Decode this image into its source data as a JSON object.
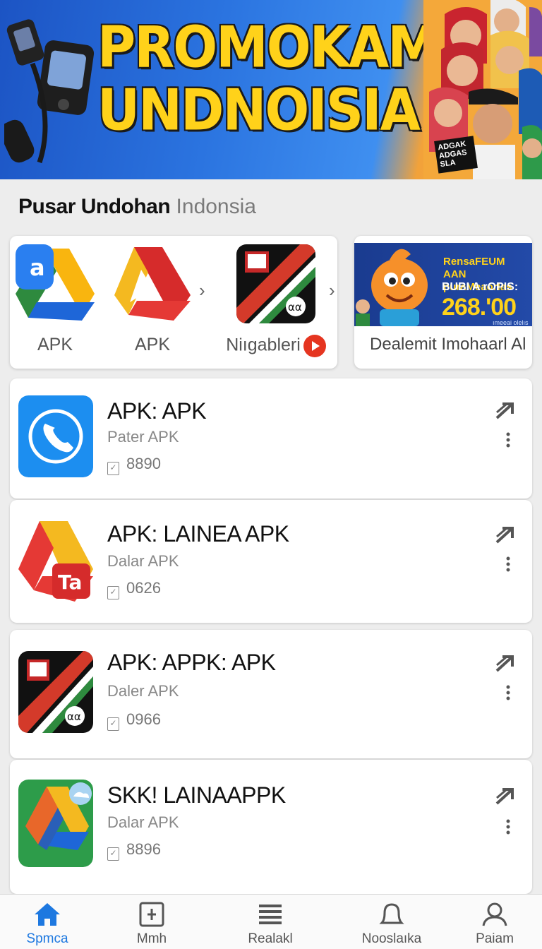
{
  "banner": {
    "title_line1": "PROMOKAM",
    "title_line2": "UNDNOISIA!",
    "sign_text": "ADGAK ADGAS SLA"
  },
  "section": {
    "title_bold": "Pusar Undohan",
    "title_light": "Indonsia"
  },
  "carousel": {
    "items": [
      {
        "label": "APK",
        "icon": "drive-a-icon"
      },
      {
        "label": "APK",
        "icon": "drive-red-icon"
      },
      {
        "label": "Niıgableri",
        "icon": "flag-app-icon"
      }
    ],
    "promo": {
      "line1": "RensaFEUM AAN puraMeaorlas",
      "line2": "BUBI A rOPIS:",
      "price": "268.'00",
      "sub": "ımeeai olelıs",
      "caption": "Dealemit Imohaarl Al"
    }
  },
  "apps": [
    {
      "name": "APK: APK",
      "sub": "Pater APK",
      "count": "8890",
      "icon": "phone-icon"
    },
    {
      "name": "APK: LAINEA APK",
      "sub": "Dalar APK",
      "count": "0626",
      "icon": "drive-ta-icon"
    },
    {
      "name": "APK: APPK: APK",
      "sub": "Daler APK",
      "count": "0966",
      "icon": "flag-app-icon"
    },
    {
      "name": "SKK! LAINAAPPK",
      "sub": "Dalar APK",
      "count": "8896",
      "icon": "drive-cloud-icon"
    }
  ],
  "nav": [
    {
      "label": "Spmca",
      "icon": "home-icon",
      "active": true
    },
    {
      "label": "Mmh",
      "icon": "calendar-icon",
      "active": false
    },
    {
      "label": "Realakl",
      "icon": "list-icon",
      "active": false
    },
    {
      "label": "Nooslaıka",
      "icon": "bell-icon",
      "active": false
    },
    {
      "label": "Paiam",
      "icon": "person-icon",
      "active": false
    }
  ],
  "colors": {
    "accent": "#1d78e0",
    "banner_title": "#ffd21a",
    "banner_bg": "#2b74e0"
  }
}
